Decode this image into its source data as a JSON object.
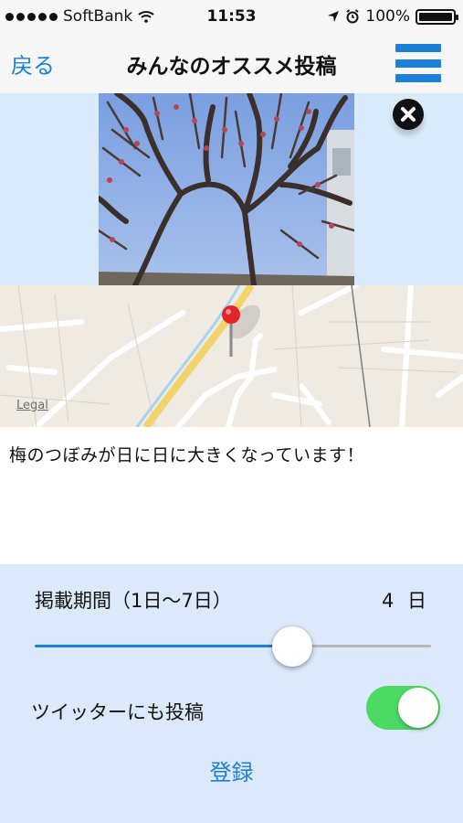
{
  "status_bar": {
    "carrier": "SoftBank",
    "time": "11:53",
    "battery": "100%",
    "battery_level": 1.0,
    "signal_dots": 5
  },
  "nav": {
    "back_label": "戻る",
    "title": "みんなのオススメ投稿",
    "menu_icon": "hamburger-menu-icon"
  },
  "post": {
    "photo_description_icon": "photo",
    "close_icon": "close-icon",
    "map_legal": "Legal",
    "comment": "梅のつぼみが日に日に大きくなっています！"
  },
  "settings": {
    "period_label": "掲載期間（1日〜7日）",
    "period_value": "4 日",
    "period_slider": {
      "min": 1,
      "max": 7,
      "value": 4.9
    },
    "tweet_label": "ツイッターにも投稿",
    "tweet_enabled": true,
    "submit_label": "登録"
  },
  "colors": {
    "accent": "#1a7fd6",
    "menu_blue": "#1c7fd8",
    "toggle_on": "#4cd964",
    "settings_bg": "#dbe9fa",
    "photo_band_bg": "#d9ebfb"
  }
}
